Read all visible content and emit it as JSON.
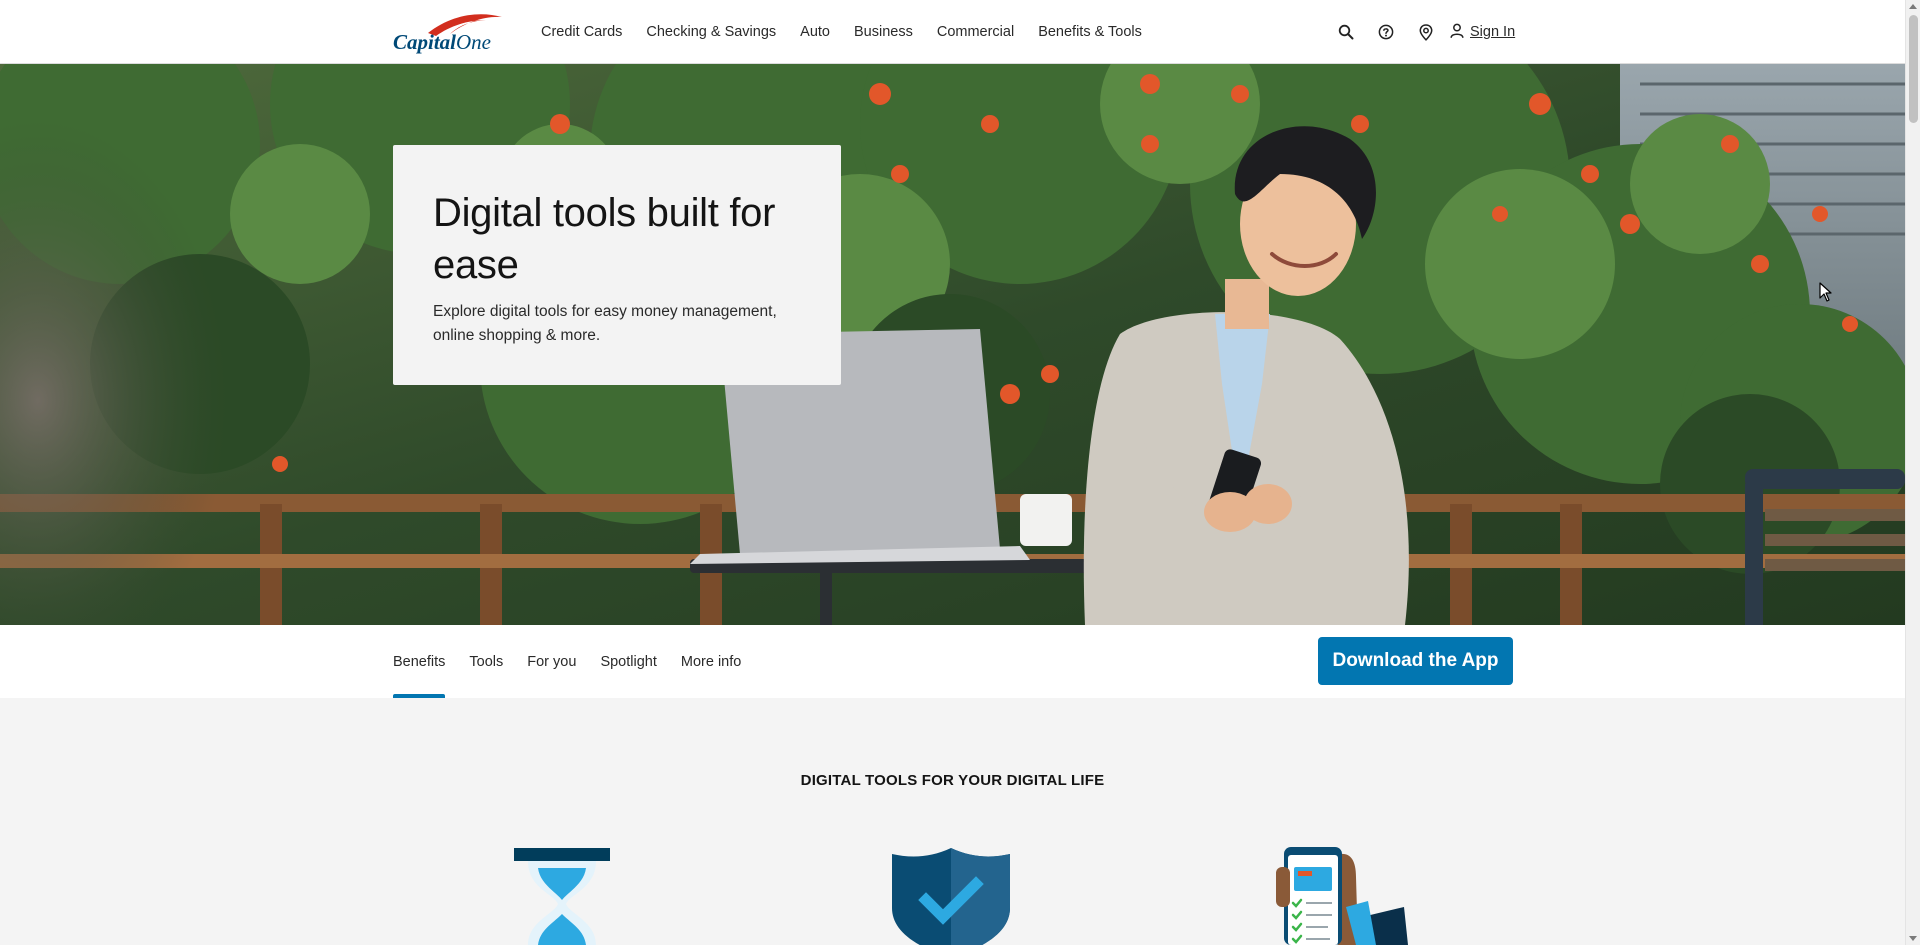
{
  "brand": {
    "logo_text": "Capital One"
  },
  "nav": {
    "links": [
      {
        "label": "Credit Cards"
      },
      {
        "label": "Checking & Savings"
      },
      {
        "label": "Auto"
      },
      {
        "label": "Business"
      },
      {
        "label": "Commercial"
      },
      {
        "label": "Benefits & Tools"
      }
    ],
    "icons": [
      "search-icon",
      "help-icon",
      "location-icon",
      "user-icon"
    ],
    "signin_label": "Sign In"
  },
  "hero": {
    "title": "Digital tools built for ease",
    "subtitle": "Explore digital tools for easy money management, online shopping & more."
  },
  "tabs": {
    "items": [
      {
        "label": "Benefits",
        "active": true
      },
      {
        "label": "Tools",
        "active": false
      },
      {
        "label": "For you",
        "active": false
      },
      {
        "label": "Spotlight",
        "active": false
      },
      {
        "label": "More info",
        "active": false
      }
    ],
    "download_label": "Download the App"
  },
  "content": {
    "section_title": "DIGITAL TOOLS FOR YOUR DIGITAL LIFE",
    "feature_icons": [
      "hourglass-icon",
      "shield-check-icon",
      "phone-checklist-icon"
    ]
  },
  "colors": {
    "accent": "#0276b1",
    "brand_red": "#d22e1e",
    "brand_navy": "#004977",
    "page_bg": "#f4f4f4"
  }
}
